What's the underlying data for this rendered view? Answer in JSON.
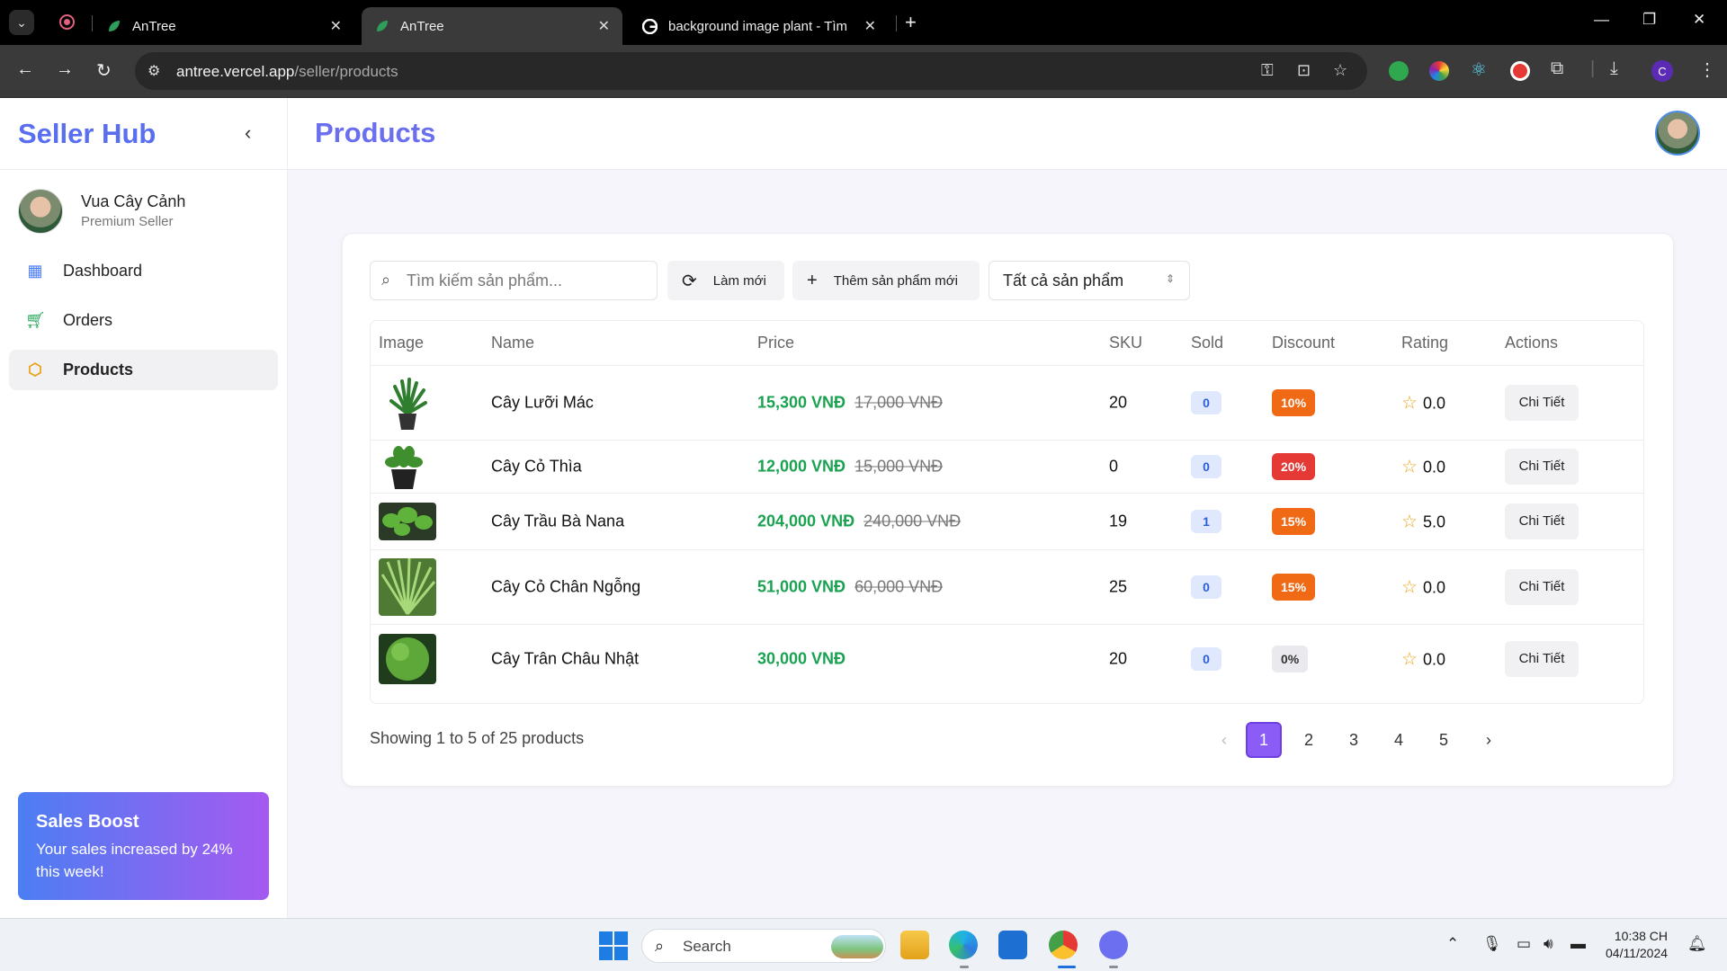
{
  "browser": {
    "tabs": [
      {
        "title": "AnTree",
        "active": false
      },
      {
        "title": "AnTree",
        "active": true
      },
      {
        "title": "background image plant - Tìm",
        "active": false
      }
    ],
    "url_host": "antree.vercel.app",
    "url_path": "/seller/products"
  },
  "sidebar": {
    "brand": "Seller Hub",
    "user_name": "Vua Cây Cảnh",
    "user_tier": "Premium Seller",
    "menu": [
      {
        "label": "Dashboard",
        "icon": "dashboard-icon",
        "active": false
      },
      {
        "label": "Orders",
        "icon": "cart-icon",
        "active": false
      },
      {
        "label": "Products",
        "icon": "box-icon",
        "active": true
      }
    ],
    "boost_title": "Sales Boost",
    "boost_desc": "Your sales increased by 24% this week!"
  },
  "header": {
    "title": "Products"
  },
  "toolbar": {
    "search_placeholder": "Tìm kiếm sản phẩm...",
    "refresh_label": "Làm mới",
    "add_label": "Thêm sản phẩm mới",
    "filter_value": "Tất cả sản phẩm"
  },
  "table": {
    "columns": [
      "Image",
      "Name",
      "Price",
      "SKU",
      "Sold",
      "Discount",
      "Rating",
      "Actions"
    ],
    "rows": [
      {
        "name": "Cây Lưỡi Mác",
        "price": "15,300 VNĐ",
        "old_price": "17,000 VNĐ",
        "sku": "20",
        "sold": "0",
        "discount": "10%",
        "discount_color": "#f06a16",
        "rating": "0.0",
        "action": "Chi Tiết"
      },
      {
        "name": "Cây Cỏ Thìa",
        "price": "12,000 VNĐ",
        "old_price": "15,000 VNĐ",
        "sku": "0",
        "sold": "0",
        "discount": "20%",
        "discount_color": "#e53935",
        "rating": "0.0",
        "action": "Chi Tiết"
      },
      {
        "name": "Cây Trầu Bà Nana",
        "price": "204,000 VNĐ",
        "old_price": "240,000 VNĐ",
        "sku": "19",
        "sold": "1",
        "discount": "15%",
        "discount_color": "#f06a16",
        "rating": "5.0",
        "action": "Chi Tiết"
      },
      {
        "name": "Cây Cỏ Chân Ngỗng",
        "price": "51,000 VNĐ",
        "old_price": "60,000 VNĐ",
        "sku": "25",
        "sold": "0",
        "discount": "15%",
        "discount_color": "#f06a16",
        "rating": "0.0",
        "action": "Chi Tiết"
      },
      {
        "name": "Cây Trân Châu Nhật",
        "price": "30,000 VNĐ",
        "old_price": "",
        "sku": "20",
        "sold": "0",
        "discount": "0%",
        "discount_color": "#e9e9ee",
        "rating": "0.0",
        "action": "Chi Tiết"
      }
    ]
  },
  "footer": {
    "showing": "Showing 1 to 5 of 25 products",
    "pages": [
      "1",
      "2",
      "3",
      "4",
      "5"
    ],
    "current_page": "1"
  },
  "taskbar": {
    "search_label": "Search",
    "time": "10:38 CH",
    "date": "04/11/2024"
  }
}
